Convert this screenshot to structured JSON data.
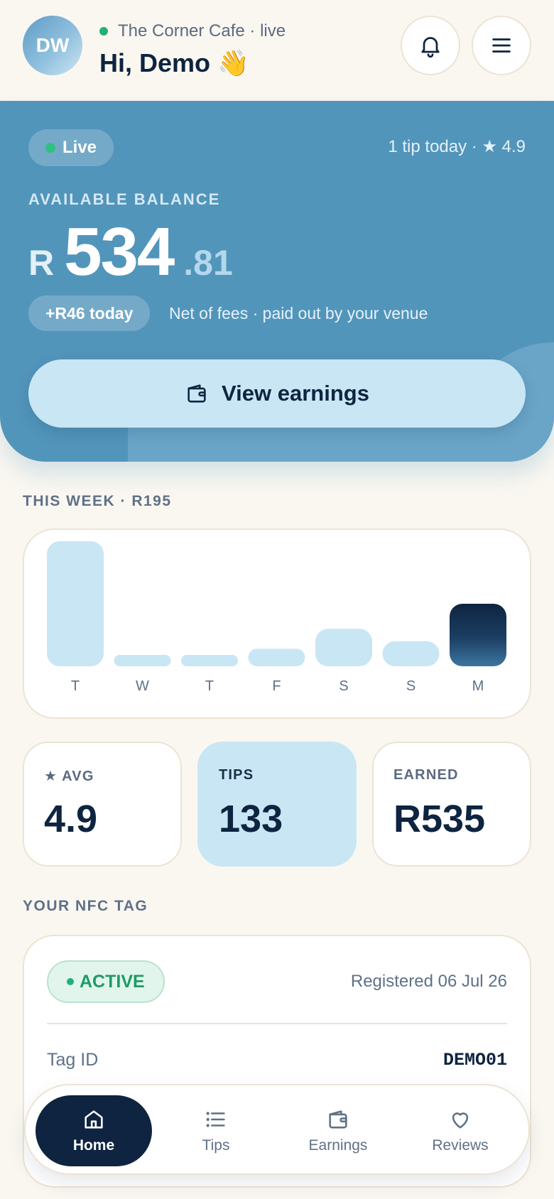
{
  "header": {
    "avatar_initials": "DW",
    "venue_status": "The Corner Cafe · live",
    "greeting": "Hi, Demo 👋"
  },
  "hero": {
    "live_label": "Live",
    "stats_text": "1 tip today · ★ 4.9",
    "balance_label": "AVAILABLE BALANCE",
    "currency": "R",
    "balance_whole": "534",
    "balance_cents": ".81",
    "today_pill": "+R46 today",
    "net_note": "Net of fees · paid out by your venue",
    "view_button": "View earnings"
  },
  "week": {
    "label": "THIS WEEK · R195"
  },
  "chart_data": {
    "type": "bar",
    "categories": [
      "T",
      "W",
      "T",
      "F",
      "S",
      "S",
      "M"
    ],
    "values": [
      100,
      9,
      9,
      14,
      30,
      20,
      50
    ],
    "highlight_index": 6
  },
  "stats": {
    "avg_label": "★ AVG",
    "avg_value": "4.9",
    "tips_label": "TIPS",
    "tips_value": "133",
    "earned_label": "EARNED",
    "earned_value": "R535"
  },
  "nfc": {
    "section_label": "YOUR NFC TAG",
    "status": "ACTIVE",
    "registered": "Registered 06 Jul 26",
    "tag_id_label": "Tag ID",
    "tag_id_value": "DEMO01"
  },
  "nav": {
    "home": "Home",
    "tips": "Tips",
    "earnings": "Earnings",
    "reviews": "Reviews"
  },
  "colors": {
    "hero_blue": "#5295bb",
    "light_blue": "#c9e6f4",
    "navy": "#0e2440",
    "green": "#22b07a",
    "background": "#faf7f1"
  }
}
